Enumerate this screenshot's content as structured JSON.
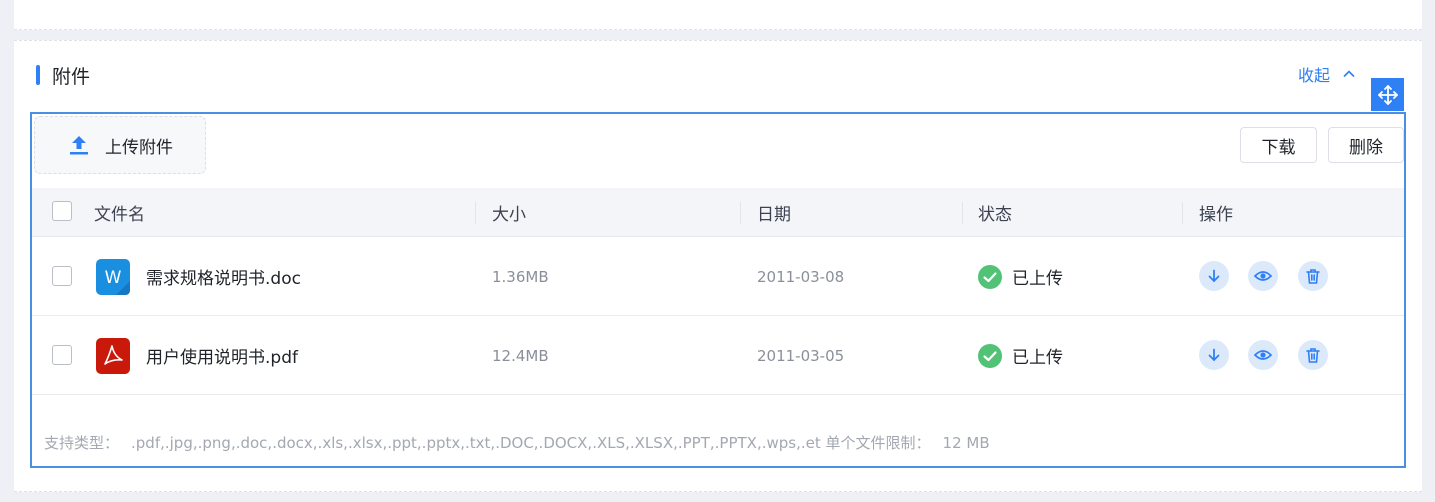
{
  "section": {
    "title": "附件",
    "collapse_label": "收起",
    "accent_color": "#2f7ff5"
  },
  "toolbar": {
    "upload_label": "上传附件",
    "download_label": "下载",
    "delete_label": "删除"
  },
  "table": {
    "columns": [
      "文件名",
      "大小",
      "日期",
      "状态",
      "操作"
    ],
    "rows": [
      {
        "icon": "word-doc-icon",
        "name": "需求规格说明书.doc",
        "size": "1.36MB",
        "date": "2011-03-08",
        "status": "已上传"
      },
      {
        "icon": "pdf-file-icon",
        "name": "用户使用说明书.pdf",
        "size": "12.4MB",
        "date": "2011-03-05",
        "status": "已上传"
      }
    ],
    "actions": [
      "download-icon",
      "eye-icon",
      "trash-icon"
    ]
  },
  "footer": {
    "types_label": "支持类型：",
    "types_value": ".pdf,.jpg,.png,.doc,.docx,.xls,.xlsx,.ppt,.pptx,.txt,.DOC,.DOCX,.XLS,.XLSX,.PPT,.PPTX,.wps,.et",
    "limit_label": "单个文件限制：",
    "limit_value": "12 MB"
  },
  "colors": {
    "success": "#52c276",
    "primary": "#2f7ff5",
    "word": "#1a8fe0",
    "pdf": "#c8190b"
  }
}
